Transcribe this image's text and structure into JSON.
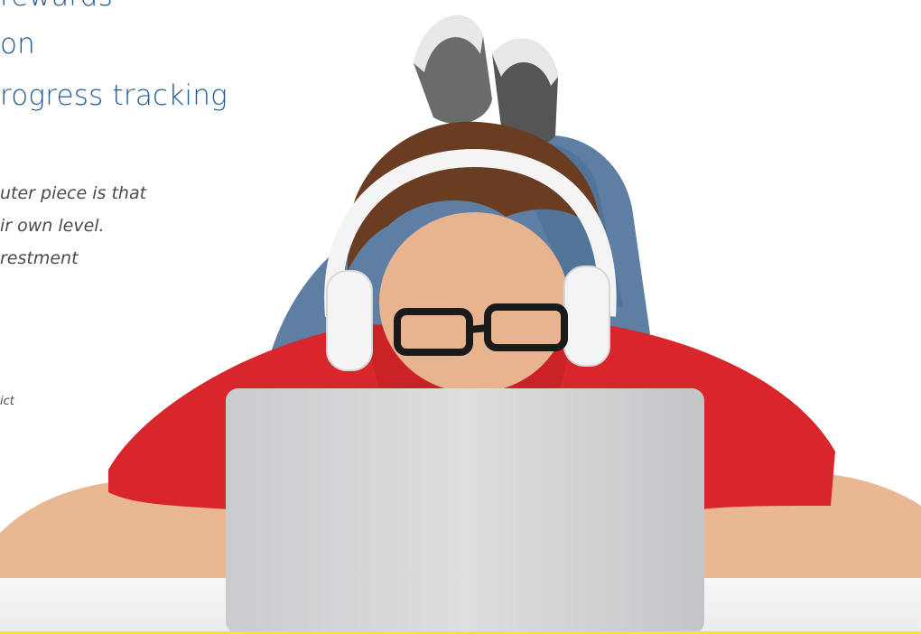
{
  "features": [
    {
      "text": "rewards"
    },
    {
      "text": "on"
    },
    {
      "text": "rogress tracking"
    }
  ],
  "quote": {
    "lines": [
      "uter piece is that",
      "ir own level.",
      "restment"
    ]
  },
  "attribution": "ict",
  "photo": {
    "subject": "boy-with-headphones-and-laptop",
    "shirt_color": "#d9262b",
    "laptop_color": "#d4d6d9",
    "headphones_color": "#f4f4f4",
    "jeans_color": "#5e7fa3"
  },
  "colors": {
    "feature_text": "#1f5a9a",
    "quote_text": "#4a4a4a",
    "bottom_rule": "#f2e24a"
  }
}
